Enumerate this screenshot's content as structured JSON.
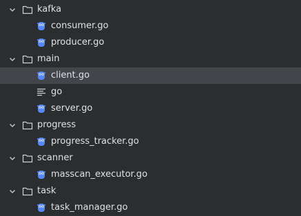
{
  "tree": {
    "kafka": {
      "label": "kafka",
      "files": [
        "consumer.go",
        "producer.go"
      ]
    },
    "main": {
      "label": "main",
      "files": [
        "client.go",
        "go",
        "server.go"
      ]
    },
    "progress": {
      "label": "progress",
      "files": [
        "progress_tracker.go"
      ]
    },
    "scanner": {
      "label": "scanner",
      "files": [
        "masscan_executor.go"
      ]
    },
    "task": {
      "label": "task",
      "files": [
        "task_manager.go"
      ]
    }
  },
  "selected_file": "client.go",
  "colors": {
    "background": "#2b2d30",
    "selected_row": "#43454a",
    "text": "#dfe1e5",
    "icon_gray": "#ced0d6",
    "gopher_blue": "#548af7"
  },
  "icons": {
    "folder": "folder-icon",
    "chevron": "chevron-down-icon",
    "go_file": "gopher-icon",
    "text_file": "text-file-icon"
  }
}
